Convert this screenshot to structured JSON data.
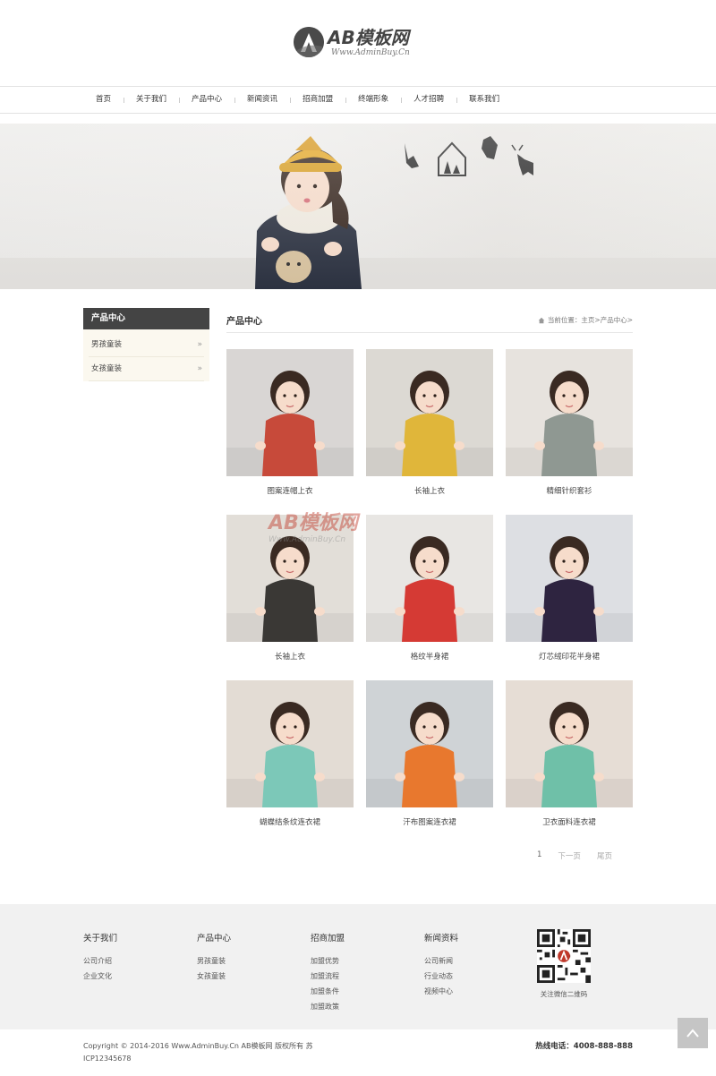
{
  "logo": {
    "title": "AB模板网",
    "subtitle": "Www.AdminBuy.Cn"
  },
  "nav": {
    "items": [
      "首页",
      "关于我们",
      "产品中心",
      "新闻资讯",
      "招商加盟",
      "终端形象",
      "人才招聘",
      "联系我们"
    ]
  },
  "sidebar": {
    "title": "产品中心",
    "items": [
      {
        "label": "男孩童装",
        "arrow": "»"
      },
      {
        "label": "女孩童装",
        "arrow": "»"
      }
    ]
  },
  "main": {
    "title": "产品中心",
    "breadcrumb": {
      "prefix": "当前位置：",
      "home": "主页",
      "sep": " > ",
      "current": "产品中心",
      "tail": " >"
    }
  },
  "products": [
    {
      "caption": "图案连帽上衣",
      "bg": "#d9d6d4",
      "accent": "#c74a3a"
    },
    {
      "caption": "长袖上衣",
      "bg": "#dcd9d3",
      "accent": "#e0b63a"
    },
    {
      "caption": "精细针织套衫",
      "bg": "#e7e3de",
      "accent": "#8f9892"
    },
    {
      "caption": "长袖上衣",
      "bg": "#e2ded8",
      "accent": "#3a3835"
    },
    {
      "caption": "格纹半身裙",
      "bg": "#e8e6e3",
      "accent": "#d53a34"
    },
    {
      "caption": "灯芯绒印花半身裙",
      "bg": "#dddfe3",
      "accent": "#2e2440"
    },
    {
      "caption": "蝴蝶结条纹连衣裙",
      "bg": "#e3dcd4",
      "accent": "#7cc8b8"
    },
    {
      "caption": "汗布图案连衣裙",
      "bg": "#cfd3d6",
      "accent": "#e8782e"
    },
    {
      "caption": "卫衣面料连衣裙",
      "bg": "#e6ddd5",
      "accent": "#6fc0a8"
    }
  ],
  "pager": {
    "current": "1",
    "next": "下一页",
    "last": "尾页"
  },
  "watermark": {
    "title": "AB模板网",
    "sub": "Www.AdminBuy.Cn"
  },
  "footer": {
    "columns": [
      {
        "title": "关于我们",
        "links": [
          "公司介绍",
          "企业文化"
        ]
      },
      {
        "title": "产品中心",
        "links": [
          "男孩童装",
          "女孩童装"
        ]
      },
      {
        "title": "招商加盟",
        "links": [
          "加盟优势",
          "加盟流程",
          "加盟条件",
          "加盟政策"
        ]
      },
      {
        "title": "新闻资料",
        "links": [
          "公司新闻",
          "行业动态",
          "视频中心"
        ]
      }
    ],
    "qr_caption": "关注微信二维码",
    "copyright": "Copyright © 2014-2016 Www.AdminBuy.Cn AB模板网 版权所有  苏ICP12345678",
    "hotline": "热线电话：4008-888-888"
  }
}
